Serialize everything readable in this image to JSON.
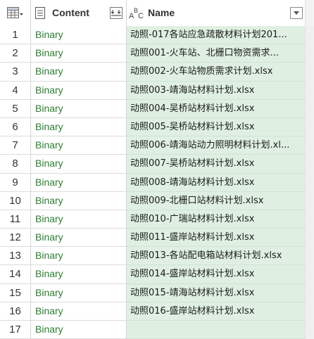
{
  "header": {
    "content_label": "Content",
    "name_label": "Name",
    "name_type_icon": "ABC-text-type-icon",
    "content_type_icon": "document-icon",
    "table_icon": "table-icon",
    "expand_icon": "expand-columns-icon",
    "filter_icon": "filter-dropdown-icon"
  },
  "rows": [
    {
      "index": "1",
      "content": "Binary",
      "name": "动照-017各站应急疏散材料计划201..."
    },
    {
      "index": "2",
      "content": "Binary",
      "name": "动照001-火车站、北栅口物资需求..."
    },
    {
      "index": "3",
      "content": "Binary",
      "name": "动照002-火车站物质需求计划.xlsx"
    },
    {
      "index": "4",
      "content": "Binary",
      "name": "动照003-靖海站材料计划.xlsx"
    },
    {
      "index": "5",
      "content": "Binary",
      "name": "动照004-吴桥站材料计划.xlsx"
    },
    {
      "index": "6",
      "content": "Binary",
      "name": "动照005-吴桥站材料计划.xlsx"
    },
    {
      "index": "7",
      "content": "Binary",
      "name": "动照006-靖海站动力照明材料计划.xl..."
    },
    {
      "index": "8",
      "content": "Binary",
      "name": "动照007-吴桥站材料计划.xlsx"
    },
    {
      "index": "9",
      "content": "Binary",
      "name": "动照008-靖海站材料计划.xlsx"
    },
    {
      "index": "10",
      "content": "Binary",
      "name": "动照009-北栅口站材料计划.xlsx"
    },
    {
      "index": "11",
      "content": "Binary",
      "name": "动照010-广瑞站材料计划.xlsx"
    },
    {
      "index": "12",
      "content": "Binary",
      "name": "动照011-盛岸站材料计划.xlsx"
    },
    {
      "index": "13",
      "content": "Binary",
      "name": "动照013-各站配电箱站材料计划.xlsx"
    },
    {
      "index": "14",
      "content": "Binary",
      "name": "动照014-盛岸站材料计划.xlsx"
    },
    {
      "index": "15",
      "content": "Binary",
      "name": "动照015-靖海站材料计划.xlsx"
    },
    {
      "index": "16",
      "content": "Binary",
      "name": "动照016-盛岸站材料计划.xlsx"
    },
    {
      "index": "17",
      "content": "Binary",
      "name": ""
    }
  ],
  "colors": {
    "content_text": "#2e7d32",
    "name_bg": "#dff0e3"
  }
}
